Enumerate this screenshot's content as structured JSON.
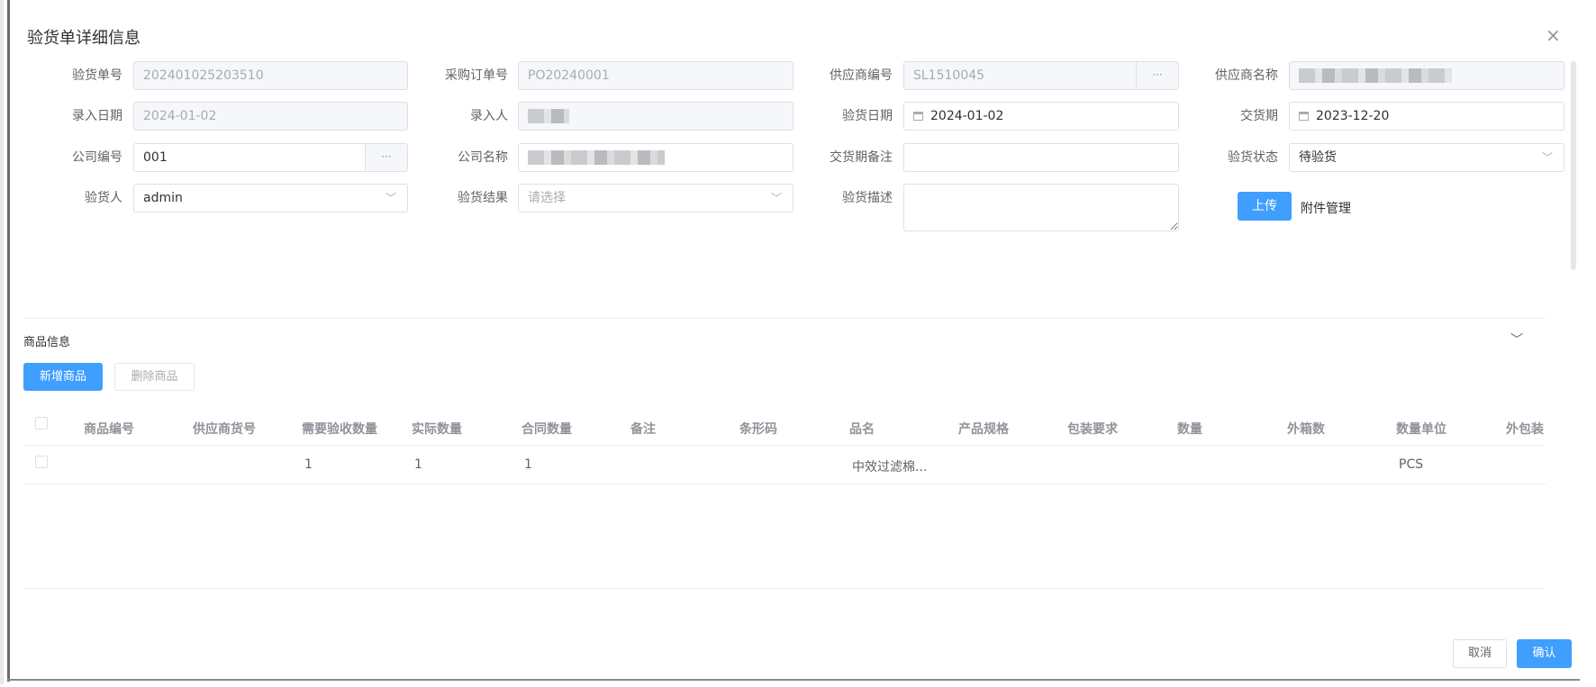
{
  "dialog": {
    "title": "验货单详细信息",
    "close_symbol": "×"
  },
  "form": {
    "inspection_no": {
      "label": "验货单号",
      "value": "202401025203510"
    },
    "po_no": {
      "label": "采购订单号",
      "value": "PO20240001"
    },
    "supplier_code": {
      "label": "供应商编号",
      "value": "SL1510045",
      "button": "···"
    },
    "supplier_name": {
      "label": "供应商名称"
    },
    "entry_date": {
      "label": "录入日期",
      "value": "2024-01-02"
    },
    "entered_by": {
      "label": "录入人"
    },
    "inspection_date": {
      "label": "验货日期",
      "value": "2024-01-02"
    },
    "delivery_date": {
      "label": "交货期",
      "value": "2023-12-20"
    },
    "company_code": {
      "label": "公司编号",
      "value": "001",
      "button": "···"
    },
    "company_name": {
      "label": "公司名称"
    },
    "delivery_note": {
      "label": "交货期备注",
      "value": ""
    },
    "inspection_status": {
      "label": "验货状态",
      "value": "待验货"
    },
    "inspector": {
      "label": "验货人",
      "value": "admin"
    },
    "inspection_result": {
      "label": "验货结果",
      "placeholder": "请选择"
    },
    "inspection_desc": {
      "label": "验货描述",
      "value": ""
    },
    "upload_label": "上传",
    "attachment_label": "附件管理"
  },
  "goods": {
    "section_title": "商品信息",
    "add_label": "新增商品",
    "delete_label": "删除商品",
    "columns": [
      "商品编号",
      "供应商货号",
      "需要验收数量",
      "实际数量",
      "合同数量",
      "备注",
      "条形码",
      "品名",
      "产品规格",
      "包装要求",
      "数量",
      "外箱数",
      "数量单位",
      "外包装"
    ],
    "rows": [
      {
        "required_qty": "1",
        "actual_qty": "1",
        "contract_qty": "1",
        "product_name": "中效过滤棉...",
        "unit": "PCS"
      }
    ]
  },
  "footer": {
    "cancel_label": "取消",
    "confirm_label": "确认"
  },
  "colors": {
    "primary": "#409eff",
    "border": "#dcdfe6",
    "disabled_bg": "#f5f7fa"
  }
}
